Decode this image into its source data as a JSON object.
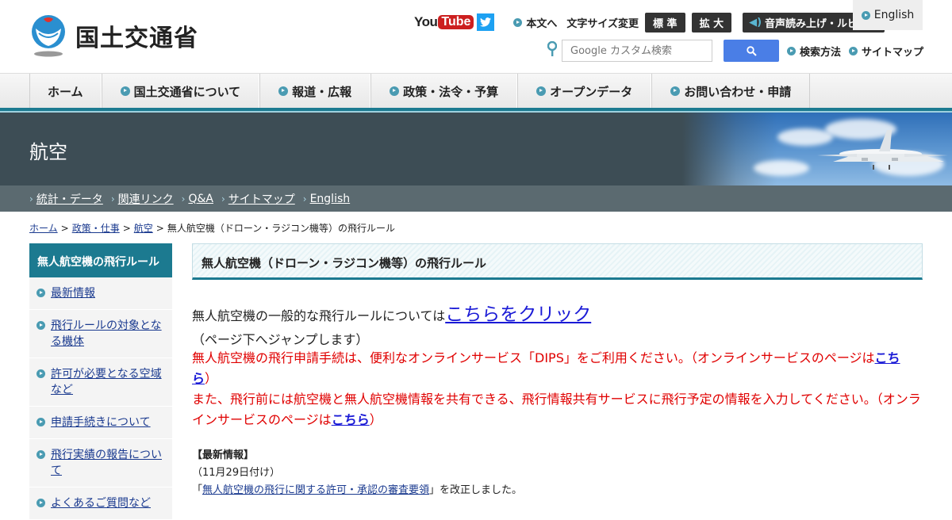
{
  "header": {
    "logo_text": "国土交通省",
    "youtube_you": "You",
    "youtube_tube": "Tube",
    "links": {
      "honbun": "本文へ",
      "size_label": "文字サイズ変更",
      "size_standard": "標 準",
      "size_large": "拡 大",
      "voice": "音声読み上げ・ルビ振り",
      "english": "English",
      "search_method": "検索方法",
      "sitemap": "サイトマップ"
    },
    "search": {
      "placeholder": "Google カスタム検索"
    }
  },
  "gnav": {
    "items": [
      "ホーム",
      "国土交通省について",
      "報道・広報",
      "政策・法令・予算",
      "オープンデータ",
      "お問い合わせ・申請"
    ]
  },
  "banner": {
    "title": "航空"
  },
  "subnav": {
    "items": [
      "統計・データ",
      "関連リンク",
      "Q&A",
      "サイトマップ",
      "English"
    ]
  },
  "breadcrumb": {
    "items": [
      "ホーム",
      "政策・仕事",
      "航空"
    ],
    "current": "無人航空機（ドローン・ラジコン機等）の飛行ルール",
    "separator": ">"
  },
  "sidenav": {
    "heading": "無人航空機の飛行ルール",
    "items": [
      "最新情報",
      "飛行ルールの対象となる機体",
      "許可が必要となる空域など",
      "申請手続きについて",
      "飛行実績の報告について",
      "よくあるご質問など"
    ]
  },
  "main": {
    "title": "無人航空機（ドローン・ラジコン機等）の飛行ルール",
    "intro_text": "無人航空機の一般的な飛行ルールについては",
    "intro_link": "こちらをクリック",
    "intro_note": "（ページ下へジャンプします）",
    "red1_text": "無人航空機の飛行申請手続は、便利なオンラインサービス「DIPS」をご利用ください。（オンラインサービスのページは",
    "red1_link": "こちら",
    "red1_end": "）",
    "red2_text": "また、飛行前には航空機と無人航空機情報を共有できる、飛行情報共有サービスに飛行予定の情報を入力してください。（オンラインサービスのページは",
    "red2_link": "こちら",
    "red2_end": "）",
    "news_heading": "【最新情報】",
    "news_date": "（11月29日付け）",
    "news_open": "「",
    "news_link": "無人航空機の飛行に関する許可・承認の審査要領",
    "news_close": "」を改正しました。"
  }
}
